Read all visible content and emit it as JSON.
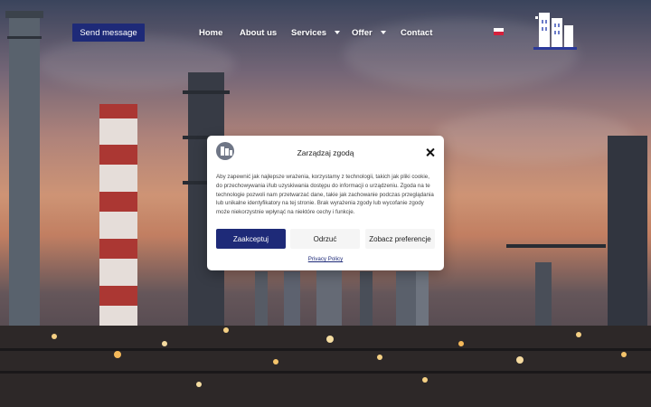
{
  "header": {
    "send_message_label": "Send message",
    "nav": [
      {
        "label": "Home"
      },
      {
        "label": "About us"
      },
      {
        "label": "Services"
      },
      {
        "label": "Offer"
      },
      {
        "label": "Contact"
      }
    ]
  },
  "consent": {
    "title": "Zarządzaj zgodą",
    "body": "Aby zapewnić jak najlepsze wrażenia, korzystamy z technologii, takich jak pliki cookie, do przechowywania i/lub uzyskiwania dostępu do informacji o urządzeniu. Zgoda na te technologie pozwoli nam przetwarzać dane, takie jak zachowanie podczas przeglądania lub unikalne identyfikatory na tej stronie. Brak wyrażenia zgody lub wycofanie zgody może niekorzystnie wpłynąć na niektóre cechy i funkcje.",
    "accept_label": "Zaakceptuj",
    "deny_label": "Odrzuć",
    "prefs_label": "Zobacz preferencje",
    "privacy_label": "Privacy Policy"
  },
  "colors": {
    "brand": "#1e2a78",
    "flag_white": "#ffffff",
    "flag_red": "#d4213d"
  },
  "icons": {
    "language": "poland-flag-icon",
    "logo": "factory-building-logo",
    "close": "close-icon"
  }
}
